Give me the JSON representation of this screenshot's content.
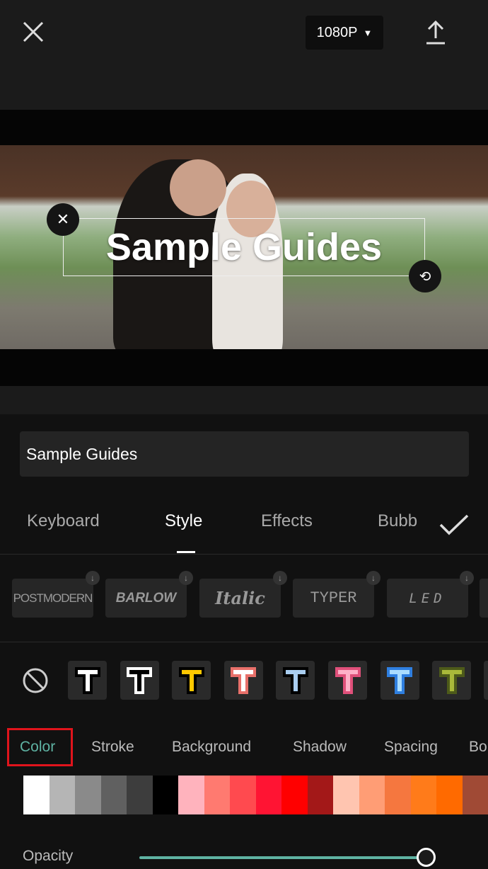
{
  "header": {
    "resolution": "1080P",
    "close_icon": "close-icon",
    "export_icon": "upload-icon"
  },
  "preview": {
    "overlay_text": "Sample Guides"
  },
  "text_input": {
    "value": "Sample Guides"
  },
  "tabs": [
    {
      "label": "Keyboard"
    },
    {
      "label": "Style",
      "active": true
    },
    {
      "label": "Effects"
    },
    {
      "label": "Bubb"
    }
  ],
  "fonts": [
    {
      "label": "POSTMODERN"
    },
    {
      "label": "BARLOW"
    },
    {
      "label": "Italic"
    },
    {
      "label": "TYPER"
    },
    {
      "label": "LED"
    }
  ],
  "presets": [
    {
      "fill": "#ffffff",
      "stroke": "#000000"
    },
    {
      "fill": "#000000",
      "stroke": "#ffffff"
    },
    {
      "fill": "#ffc800",
      "stroke": "#000000"
    },
    {
      "fill": "#ffffff",
      "stroke": "#e8706a"
    },
    {
      "fill": "#a9cdf0",
      "stroke": "#000000"
    },
    {
      "fill": "#ffb0c8",
      "stroke": "#e0507a"
    },
    {
      "fill": "#a9dcff",
      "stroke": "#2f7fe0"
    },
    {
      "fill": "#a9b83a",
      "stroke": "#4d5a1a"
    }
  ],
  "style_tabs": [
    {
      "label": "Color",
      "active": true
    },
    {
      "label": "Stroke"
    },
    {
      "label": "Background"
    },
    {
      "label": "Shadow"
    },
    {
      "label": "Spacing"
    },
    {
      "label": "Bo"
    }
  ],
  "colors": [
    "#ffffff",
    "#b5b5b5",
    "#8a8a8a",
    "#606060",
    "#3d3d3d",
    "#000000",
    "#ffb3bd",
    "#ff7a70",
    "#ff4a4f",
    "#ff1433",
    "#ff0000",
    "#a31818",
    "#ffc5b0",
    "#ff9d75",
    "#f5773f",
    "#ff7b1a",
    "#ff6a00",
    "#a04a35"
  ],
  "opacity": {
    "label": "Opacity",
    "value_percent": 100
  },
  "accent": "#5fb3a3",
  "highlight": "#e0141c"
}
